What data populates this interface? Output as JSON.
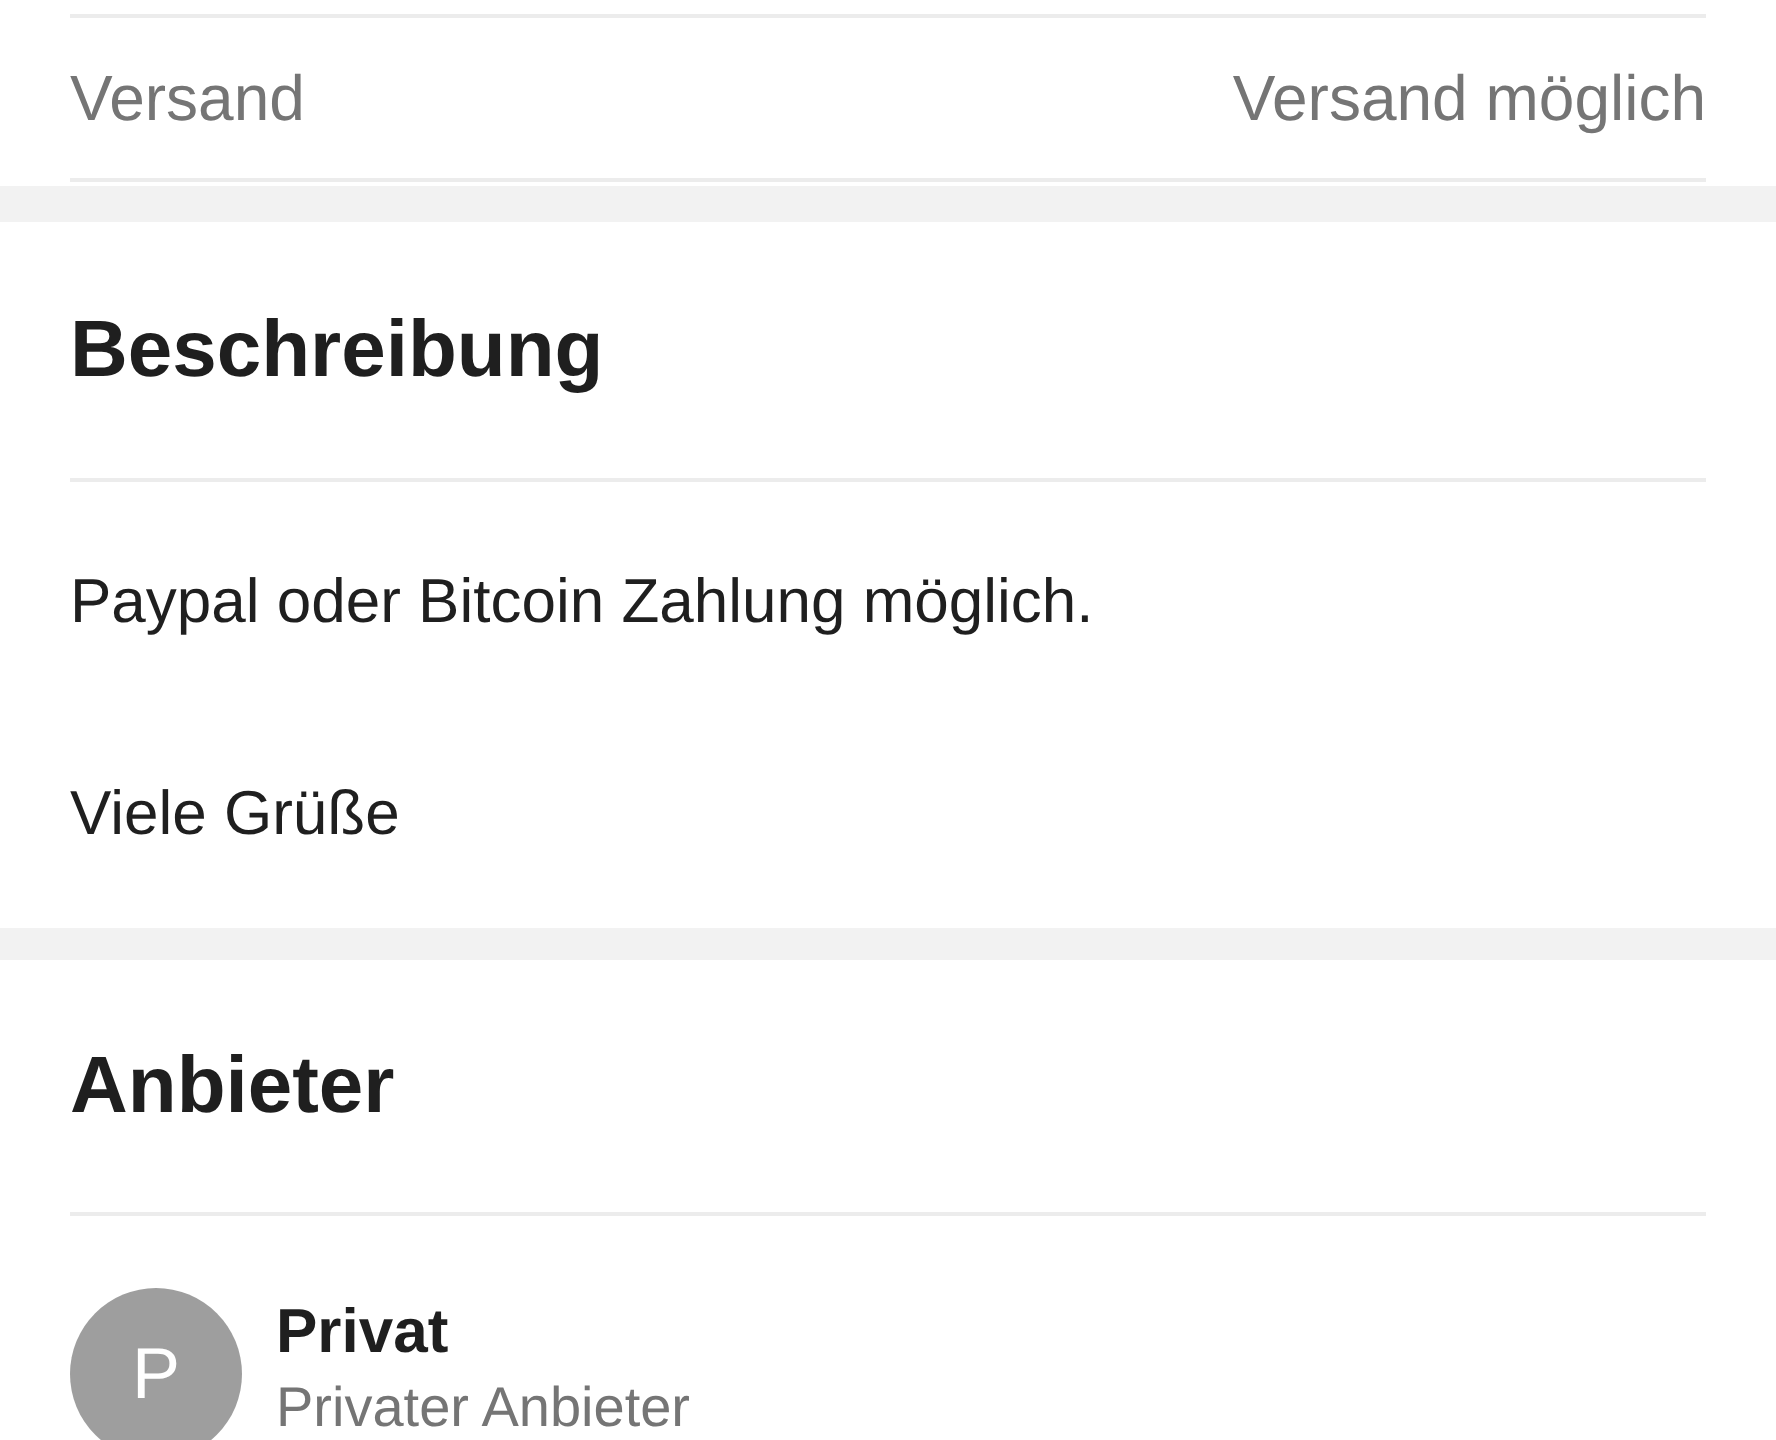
{
  "details": [
    {
      "label": "Versand",
      "value": "Versand möglich"
    }
  ],
  "description": {
    "title": "Beschreibung",
    "paragraphs": [
      "Paypal oder Bitcoin Zahlung möglich.",
      "Viele Grüße"
    ]
  },
  "seller": {
    "title": "Anbieter",
    "avatar_letter": "P",
    "name": "Privat",
    "type": "Privater Anbieter"
  }
}
